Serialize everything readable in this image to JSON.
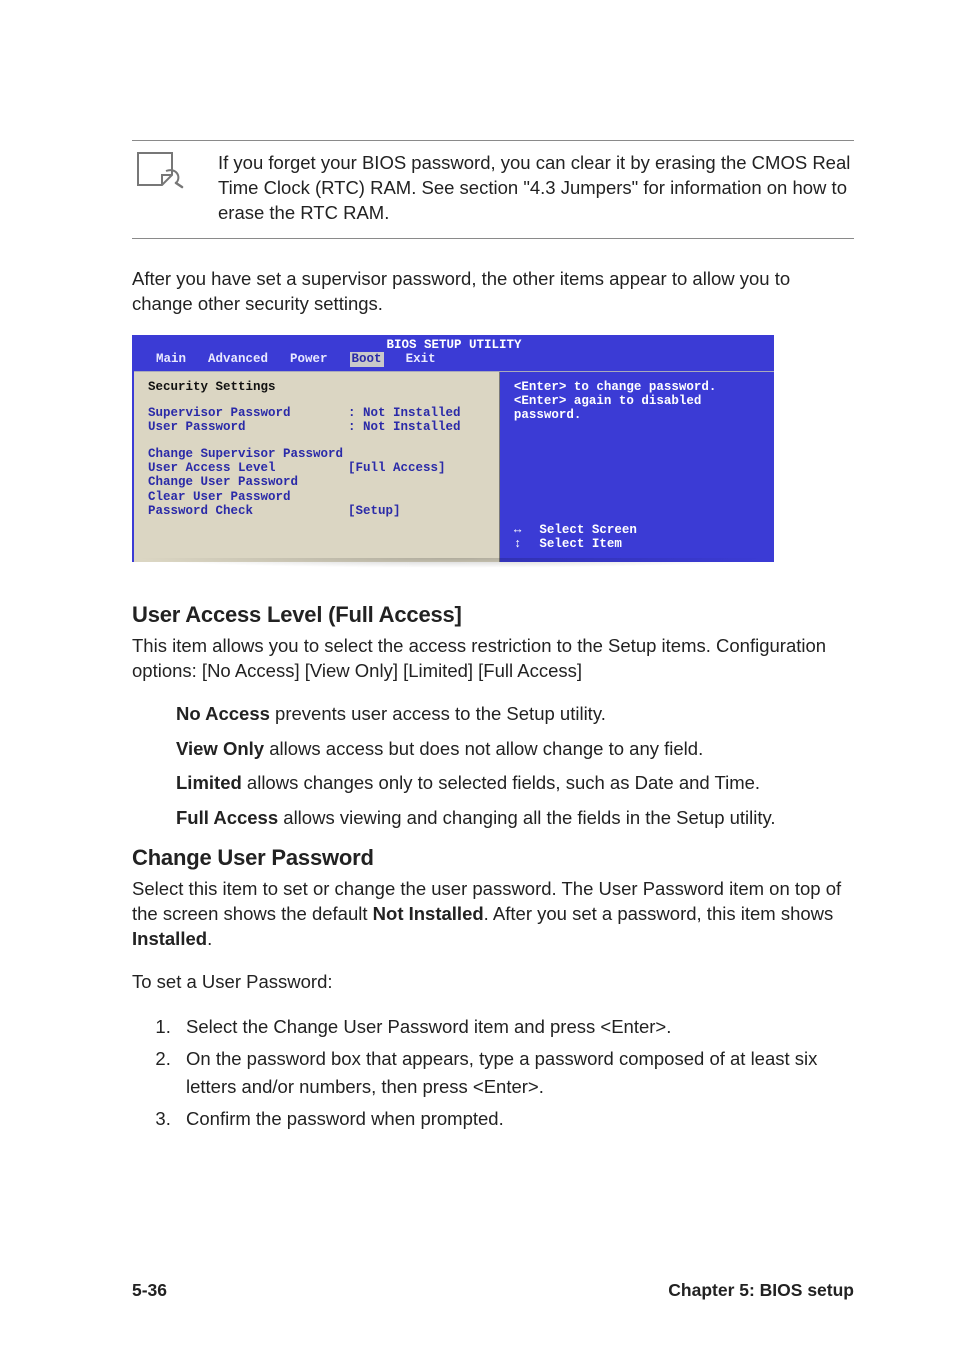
{
  "note": {
    "text": "If you forget your BIOS password, you can clear it by erasing the CMOS Real Time Clock (RTC) RAM. See section \"4.3 Jumpers\" for information on how to erase the RTC RAM."
  },
  "intro": "After you have set a supervisor password, the other items appear to allow you to change other security settings.",
  "bios": {
    "title": "BIOS SETUP UTILITY",
    "menu": [
      "Main",
      "Advanced",
      "Power",
      "Boot",
      "Exit"
    ],
    "selected_menu": "Boot",
    "left": {
      "heading": "Security Settings",
      "supervisor_label": "Supervisor Password",
      "supervisor_value": ": Not Installed",
      "user_label": "User Password",
      "user_value": ": Not Installed",
      "change_sup": "Change Supervisor Password",
      "ual_label": "User Access Level",
      "ual_value": "[Full Access]",
      "change_user": "Change User Password",
      "clear_user": "Clear User Password",
      "pwcheck_label": "Password Check",
      "pwcheck_value": "[Setup]"
    },
    "right": {
      "help": "<Enter> to change password.\n<Enter> again to disabled password.",
      "nav1": "Select Screen",
      "nav2": "Select Item"
    }
  },
  "sections": {
    "ual": {
      "heading": "User Access Level (Full Access]",
      "body": "This item allows you to select the access restriction to the Setup items. Configuration options: [No Access] [View Only] [Limited] [Full Access]",
      "opts": {
        "no_access_b": "No Access",
        "no_access_t": " prevents user access to the Setup utility.",
        "view_only_b": "View Only",
        "view_only_t": " allows access but does not allow change to any field.",
        "limited_b": "Limited",
        "limited_t": " allows changes only to selected fields, such as Date and Time.",
        "full_b": "Full Access",
        "full_t": " allows viewing and changing all the fields in the Setup utility."
      }
    },
    "cup": {
      "heading": "Change User Password",
      "body_pre": "Select this item to set or change the user password. The User Password item on top of the screen shows the default ",
      "not_installed": "Not Installed",
      "body_mid": ". After you set a password, this item shows ",
      "installed": "Installed",
      "body_post": ".",
      "toset": "To set a User Password:",
      "steps": [
        "Select the Change User Password item and press <Enter>.",
        "On the password box that appears, type a password composed of at least six letters and/or numbers, then press <Enter>.",
        "Confirm the password when prompted."
      ]
    }
  },
  "footer": {
    "left": "5-36",
    "right": "Chapter 5: BIOS setup"
  }
}
